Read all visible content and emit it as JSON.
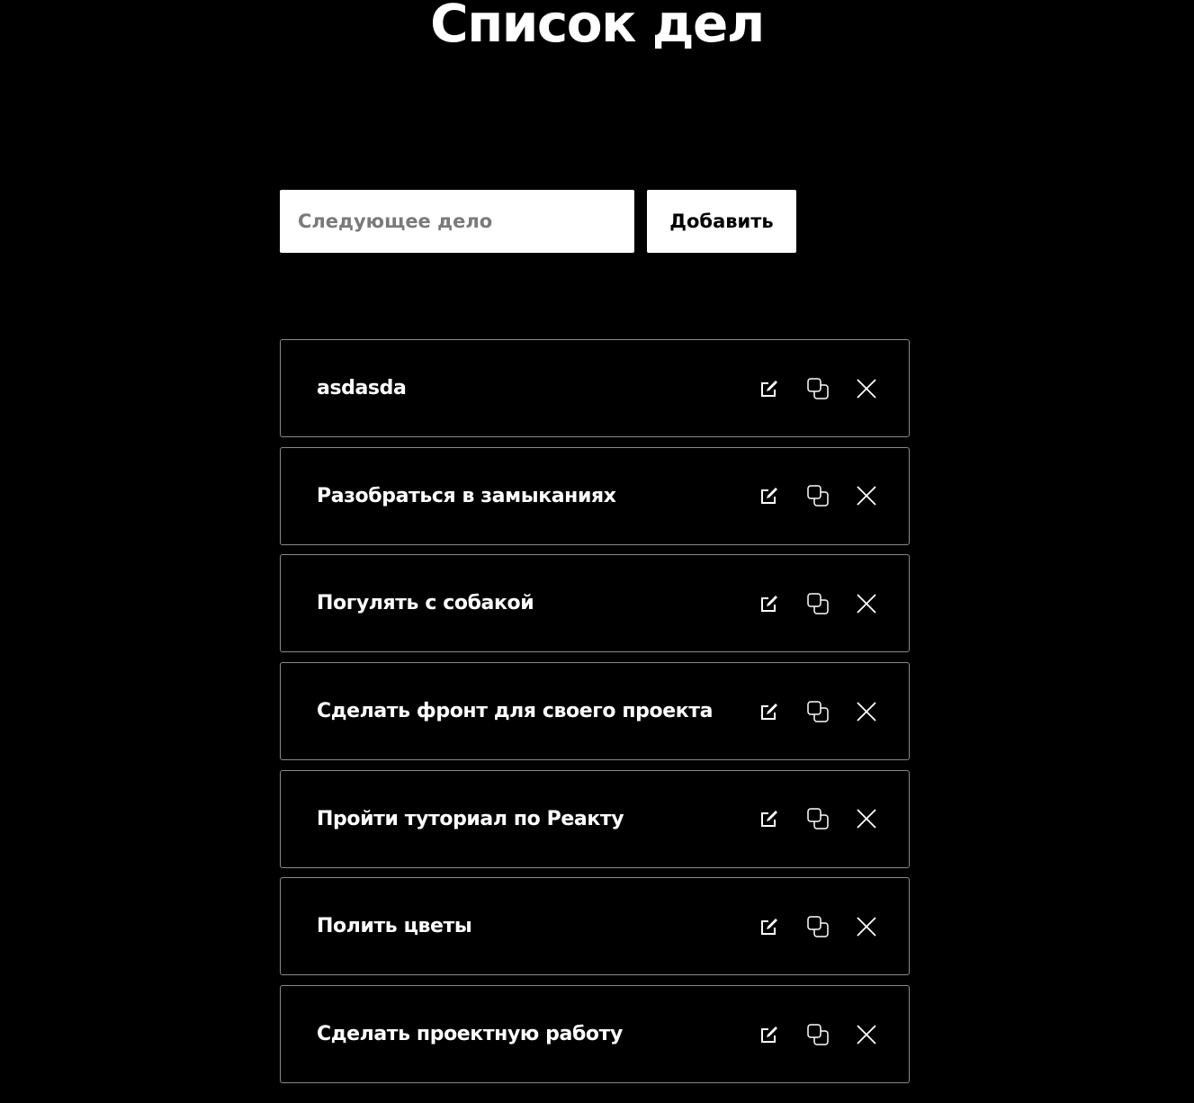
{
  "page": {
    "title": "Список дел"
  },
  "form": {
    "placeholder": "Следующее дело",
    "add_label": "Добавить"
  },
  "todos": [
    {
      "text": "asdasda"
    },
    {
      "text": "Разобраться в замыканиях"
    },
    {
      "text": "Погулять с собакой"
    },
    {
      "text": "Сделать фронт для своего проекта"
    },
    {
      "text": "Пройти туториал по Реакту"
    },
    {
      "text": "Полить цветы"
    },
    {
      "text": "Сделать проектную работу"
    }
  ],
  "icons": {
    "edit": "edit-icon",
    "copy": "copy-icon",
    "delete": "close-icon"
  },
  "colors": {
    "background": "#000000",
    "text": "#ffffff",
    "card_border": "#8a8a8a",
    "input_background": "#ffffff",
    "placeholder": "#7a7a7a"
  }
}
